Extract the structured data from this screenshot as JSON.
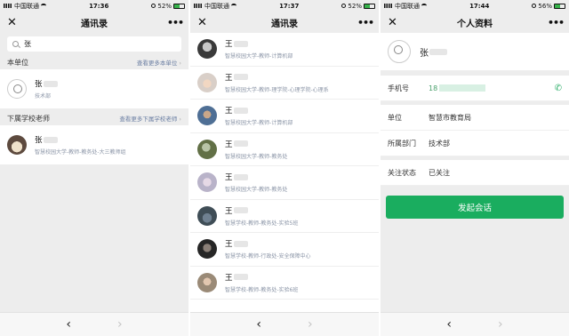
{
  "screens": [
    {
      "status": {
        "carrier": "中国联通",
        "time": "17:36",
        "battery": "52%",
        "battery_level": 0.52
      },
      "nav": {
        "title": "通讯录",
        "close": "✕",
        "more": "•••"
      },
      "search": {
        "query": "张"
      },
      "sections": [
        {
          "title": "本单位",
          "link": "查看更多本单位",
          "contacts": [
            {
              "name": "张",
              "dept": "技术部"
            }
          ]
        },
        {
          "title": "下属学校老师",
          "link": "查看更多下属学校老师",
          "contacts": [
            {
              "name": "张",
              "dept": "智慧校园大学-教师-教务处-大三教师组"
            }
          ]
        }
      ]
    },
    {
      "status": {
        "carrier": "中国联通",
        "time": "17:37",
        "battery": "52%",
        "battery_level": 0.52
      },
      "nav": {
        "title": "通讯录",
        "close": "✕",
        "more": "•••"
      },
      "contacts": [
        {
          "name": "王",
          "name_tail": "",
          "dept": "智慧校园大学-教师-计算机部"
        },
        {
          "name": "王",
          "name_tail": "",
          "dept": "智慧校园大学-教师-理学院-心理学院-心理系"
        },
        {
          "name": "王",
          "name_tail": "",
          "dept": "智慧校园大学-教师-计算机部"
        },
        {
          "name": "王",
          "name_tail": "",
          "dept": "智慧校园大学-教师-教务处"
        },
        {
          "name": "王",
          "name_tail": "",
          "dept": "智慧校园大学-教师-教务处"
        },
        {
          "name": "王",
          "name_tail": "",
          "dept": "智慧学校-教师-教务处-实验5班"
        },
        {
          "name": "王",
          "name_tail": "",
          "dept": "智慧学校-教师-行政处-安全保障中心"
        },
        {
          "name": "王",
          "name_tail": "",
          "dept": "智慧学校-教师-教务处-实验6班"
        }
      ]
    },
    {
      "status": {
        "carrier": "中国联通",
        "time": "17:44",
        "battery": "56%",
        "battery_level": 0.56
      },
      "nav": {
        "title": "个人资料",
        "close": "✕",
        "more": "•••"
      },
      "profile": {
        "name": "张"
      },
      "fields": {
        "phone_label": "手机号",
        "phone_value": "18",
        "unit_label": "单位",
        "unit_value": "智慧市教育局",
        "dept_label": "所属部门",
        "dept_value": "技术部",
        "follow_label": "关注状态",
        "follow_value": "已关注"
      },
      "action": {
        "label": "发起会话"
      }
    }
  ],
  "bottom": {
    "back": "‹",
    "forward": "›"
  },
  "colors": {
    "accent": "#1aad5f",
    "link": "#6b7fa3",
    "background": "#ededed"
  }
}
